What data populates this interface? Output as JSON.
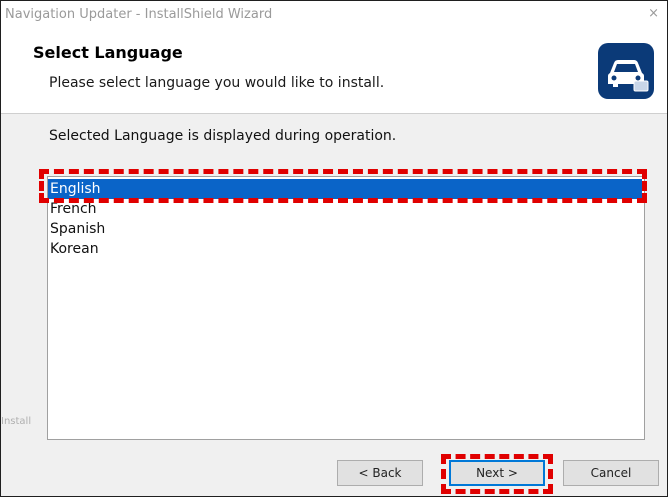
{
  "window": {
    "title": "Navigation Updater - InstallShield Wizard",
    "close_glyph": "×"
  },
  "header": {
    "title": "Select Language",
    "subtitle": "Please select language you would like to install.",
    "icon": "car-icon"
  },
  "body": {
    "prompt": "Selected Language is displayed during operation.",
    "languages": [
      {
        "label": "English",
        "selected": true
      },
      {
        "label": "French",
        "selected": false
      },
      {
        "label": "Spanish",
        "selected": false
      },
      {
        "label": "Korean",
        "selected": false
      }
    ],
    "footer_brand": "Install"
  },
  "buttons": {
    "back": "< Back",
    "next": "Next >",
    "cancel": "Cancel"
  },
  "colors": {
    "selection": "#0a64c8",
    "highlight": "#e00000",
    "icon_bg": "#0b3a78"
  }
}
